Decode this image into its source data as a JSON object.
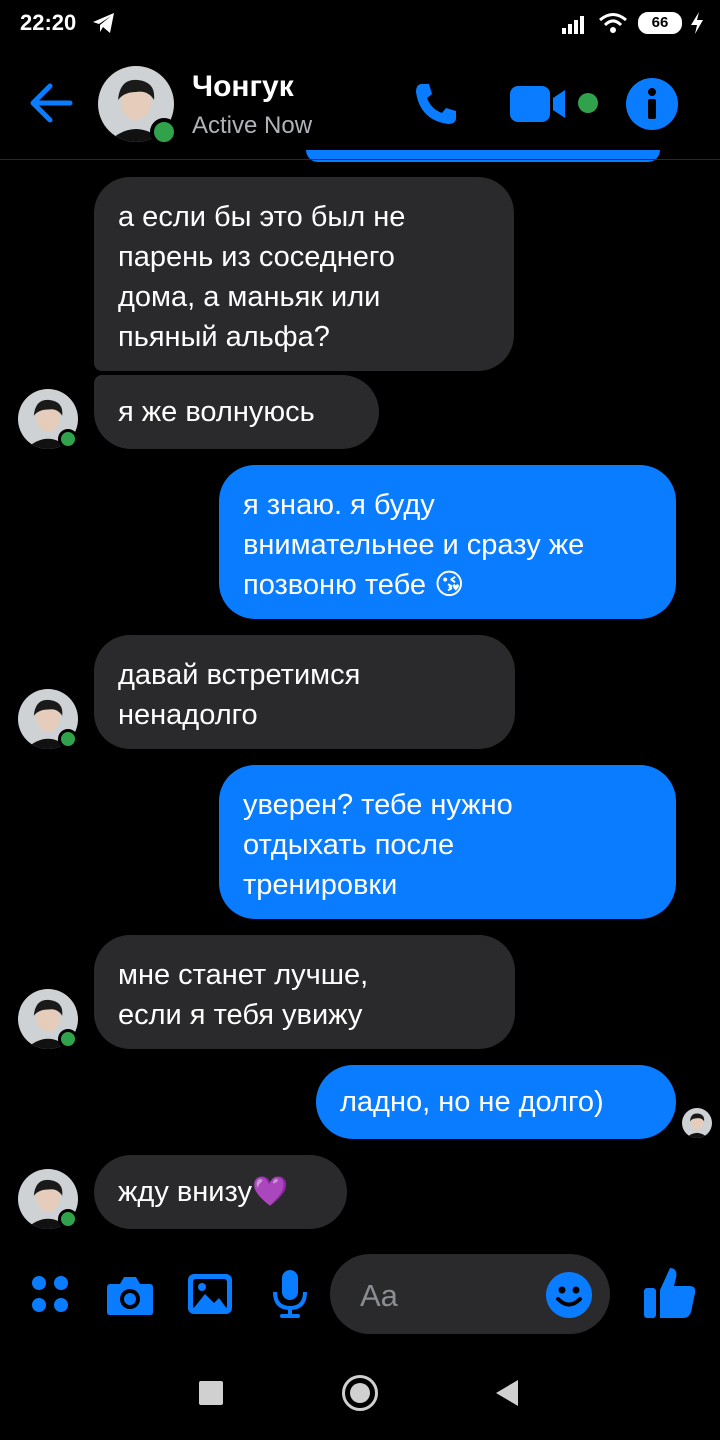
{
  "status_bar": {
    "time": "22:20",
    "battery": "66"
  },
  "header": {
    "name": "Чонгук",
    "status": "Active Now"
  },
  "messages": [
    {
      "side": "in",
      "text": "а если бы это был не\nпарень из соседнего\nдома, а маньяк или\nпьяный альфа?"
    },
    {
      "side": "in",
      "text": "я же волнуюсь"
    },
    {
      "side": "out",
      "text": "я знаю. я буду\nвнимательнее и сразу же\nпозвоню тебе 😘"
    },
    {
      "side": "in",
      "text": "давай встретимся\nненадолго"
    },
    {
      "side": "out",
      "text": "уверен? тебе нужно\nотдыхать после\nтренировки"
    },
    {
      "side": "in",
      "text": "мне станет лучше,\nесли я тебя увижу"
    },
    {
      "side": "out",
      "text": "ладно, но не долго)"
    },
    {
      "side": "in",
      "text": "жду внизу💜"
    }
  ],
  "composer": {
    "placeholder": "Aa"
  },
  "icons": {
    "back": "arrow-left-icon",
    "call": "phone-icon",
    "video": "video-camera-icon",
    "info": "info-icon",
    "menu": "four-dots-icon",
    "camera": "camera-icon",
    "gallery": "image-icon",
    "mic": "microphone-icon",
    "emoji": "smiley-icon",
    "like": "thumbs-up-icon"
  },
  "colors": {
    "accent": "#0a7cff",
    "incoming_bubble": "#2a2a2c",
    "online": "#31a24c",
    "background": "#000000"
  }
}
